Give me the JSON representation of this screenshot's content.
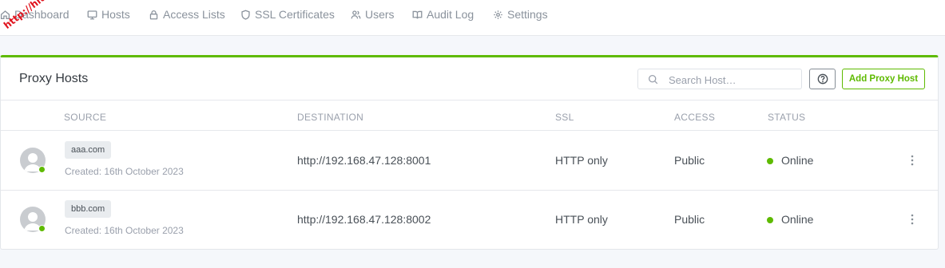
{
  "nav": {
    "items": [
      {
        "label": "Dashboard",
        "icon": "home-icon"
      },
      {
        "label": "Hosts",
        "icon": "monitor-icon"
      },
      {
        "label": "Access Lists",
        "icon": "lock-icon"
      },
      {
        "label": "SSL Certificates",
        "icon": "shield-icon"
      },
      {
        "label": "Users",
        "icon": "users-icon"
      },
      {
        "label": "Audit Log",
        "icon": "book-icon"
      },
      {
        "label": "Settings",
        "icon": "gear-icon"
      }
    ]
  },
  "watermark": "http://hiuli.kr",
  "card": {
    "title": "Proxy Hosts",
    "search_placeholder": "Search Host…",
    "add_button": "Add Proxy Host",
    "help_icon": "question-circle-icon"
  },
  "table": {
    "headers": [
      "SOURCE",
      "DESTINATION",
      "SSL",
      "ACCESS",
      "STATUS"
    ],
    "rows": [
      {
        "host": "aaa.com",
        "created": "Created: 16th October 2023",
        "destination": "http://192.168.47.128:8001",
        "ssl": "HTTP only",
        "access": "Public",
        "status": "Online"
      },
      {
        "host": "bbb.com",
        "created": "Created: 16th October 2023",
        "destination": "http://192.168.47.128:8002",
        "ssl": "HTTP only",
        "access": "Public",
        "status": "Online"
      }
    ]
  },
  "colors": {
    "accent": "#5eba00",
    "online": "#5eba00",
    "watermark": "#e0141e"
  }
}
